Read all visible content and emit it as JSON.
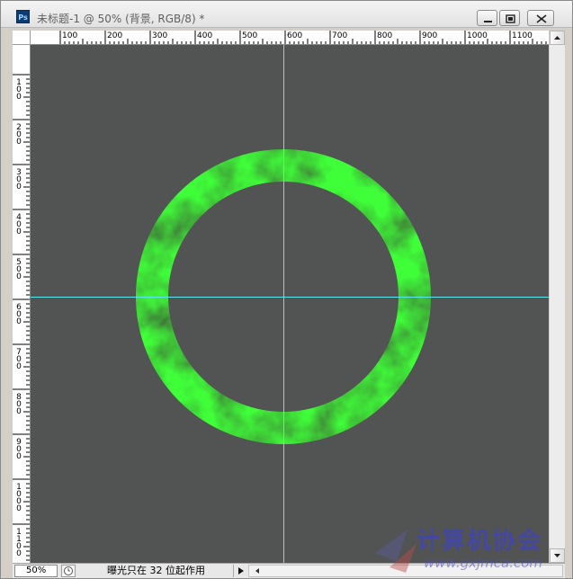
{
  "window": {
    "app_icon_label": "Ps",
    "title": "未标题-1 @ 50% (背景, RGB/8) *"
  },
  "ruler_horizontal": [
    "100",
    "200",
    "300",
    "400",
    "500",
    "600",
    "700",
    "800",
    "900",
    "1000",
    "1100"
  ],
  "ruler_vertical": [
    "1\n0\n0",
    "2\n0\n0",
    "3\n0\n0",
    "4\n0\n0",
    "5\n0\n0",
    "6\n0\n0",
    "7\n0\n0",
    "8\n0\n0",
    "9\n0\n0",
    "1\n0\n0\n0",
    "1\n1\n0\n0"
  ],
  "canvas": {
    "background_color": "#525453",
    "guide_color": "#5ce5ea",
    "ring_color_light": "#66e066",
    "ring_color_dark": "#0d3d0d"
  },
  "status_bar": {
    "zoom": "50%",
    "message": "曝光只在 32 位起作用"
  },
  "watermark": {
    "text": "计算机协会",
    "url": "www.gxjmca.com"
  }
}
